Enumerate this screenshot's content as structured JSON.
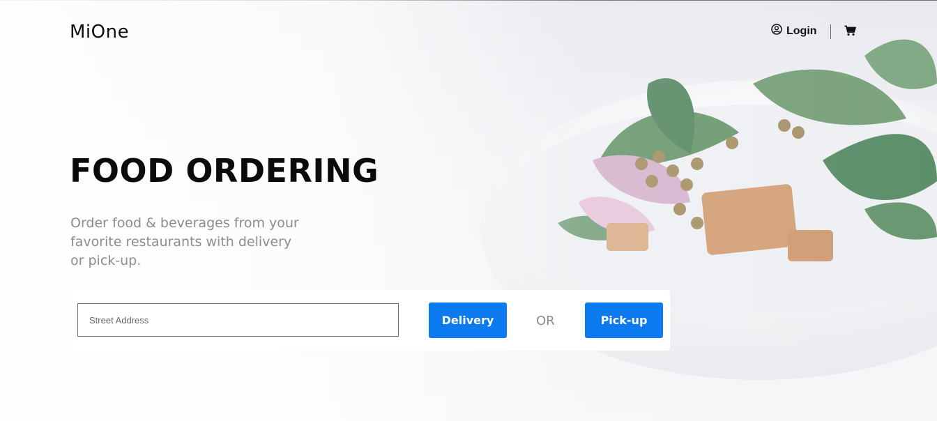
{
  "brand": {
    "logo": "MiOne"
  },
  "nav": {
    "login_label": "Login"
  },
  "hero": {
    "title": "FOOD ORDERING",
    "subtitle": "Order food & beverages from your favorite restaurants with delivery or pick-up."
  },
  "order": {
    "address_placeholder": "Street Address",
    "address_value": "",
    "delivery_label": "Delivery",
    "or_label": "OR",
    "pickup_label": "Pick-up"
  },
  "colors": {
    "accent": "#0d7bf0",
    "muted_text": "#8c8c8c"
  },
  "icons": {
    "login": "user-circle-icon",
    "cart": "shopping-cart-icon"
  }
}
